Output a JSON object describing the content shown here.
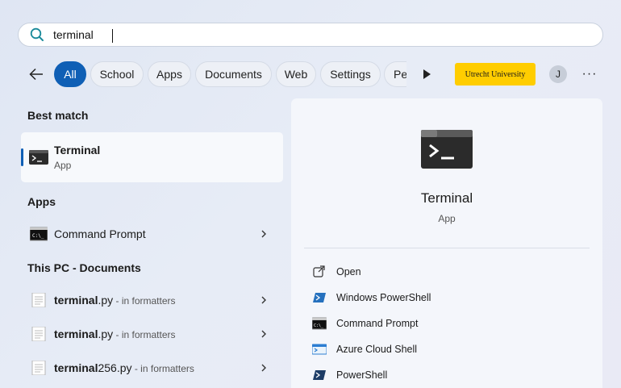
{
  "search": {
    "value": "terminal",
    "placeholder": ""
  },
  "filters": {
    "chips": [
      "All",
      "School",
      "Apps",
      "Documents",
      "Web",
      "Settings",
      "Pe"
    ],
    "active": "All",
    "org_badge": "Utrecht University",
    "avatar_initial": "J",
    "more_label": "···"
  },
  "results": {
    "best_match_heading": "Best match",
    "best_match": {
      "name": "Terminal",
      "type": "App"
    },
    "apps_heading": "Apps",
    "apps": [
      {
        "label": "Command Prompt"
      }
    ],
    "documents_heading": "This PC - Documents",
    "documents": [
      {
        "name_bold": "terminal",
        "ext": ".py",
        "location": " - in formatters"
      },
      {
        "name_bold": "terminal",
        "ext": ".py",
        "location": " - in formatters"
      },
      {
        "name_bold": "terminal",
        "ext": "256.py",
        "location": " - in formatters"
      }
    ]
  },
  "preview": {
    "title": "Terminal",
    "subtitle": "App",
    "actions": [
      "Open",
      "Windows PowerShell",
      "Command Prompt",
      "Azure Cloud Shell",
      "PowerShell"
    ]
  },
  "colors": {
    "accent": "#0f5fb5",
    "badge": "#ffcd00"
  }
}
